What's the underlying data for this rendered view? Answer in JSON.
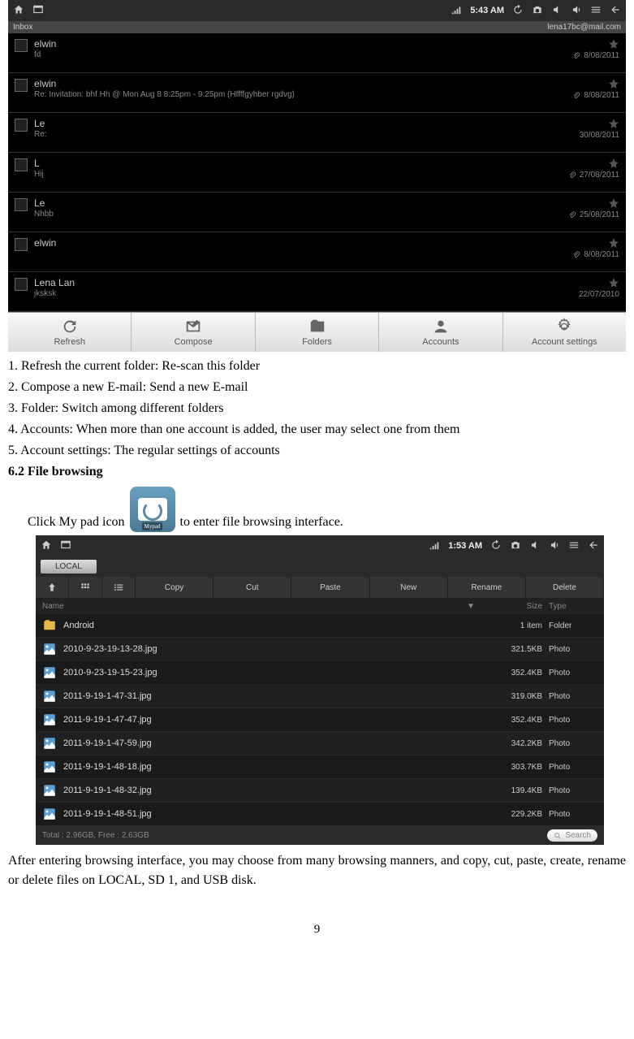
{
  "email_screenshot": {
    "statusbar": {
      "time": "5:43 AM"
    },
    "inbox_label": "Inbox",
    "account": "lena17bc@mail.com",
    "items": [
      {
        "sender": "elwin",
        "subject": "fd",
        "date": "8/08/2011",
        "attach": true
      },
      {
        "sender": "elwin",
        "subject": "Re: Invitation: bhf Hh @ Mon Aug 8 8:25pm - 9:25pm (Hffffgyhber rgdvg)",
        "date": "8/08/2011",
        "attach": true
      },
      {
        "sender": "Le",
        "subject": "Re:",
        "date": "30/08/2011",
        "attach": false
      },
      {
        "sender": "L",
        "subject": "Hij",
        "date": "27/08/2011",
        "attach": true
      },
      {
        "sender": "Le",
        "subject": "Nhbb",
        "date": "25/08/2011",
        "attach": true
      },
      {
        "sender": "elwin",
        "subject": "",
        "date": "8/08/2011",
        "attach": true
      },
      {
        "sender": "Lena Lan",
        "subject": "jksksk",
        "date": "22/07/2010",
        "attach": false
      }
    ],
    "toolbar": [
      "Refresh",
      "Compose",
      "Folders",
      "Accounts",
      "Account settings"
    ]
  },
  "doc_list": [
    "1. Refresh the current folder: Re-scan this folder",
    "2. Compose a new E-mail: Send a new E-mail",
    "3. Folder: Switch among different folders",
    "4. Accounts: When more than one account is added, the user may select one from them",
    "5. Account settings: The regular settings of accounts"
  ],
  "section_62": "6.2 File browsing",
  "mypad": {
    "pre": "Click My pad icon",
    "post": " to enter file browsing interface.",
    "label": "Mypad"
  },
  "file_screenshot": {
    "statusbar": {
      "time": "1:53 AM"
    },
    "tab": "LOCAL",
    "actions": [
      "Copy",
      "Cut",
      "Paste",
      "New",
      "Rename",
      "Delete"
    ],
    "headers": {
      "name": "Name",
      "size": "Size",
      "type": "Type"
    },
    "rows": [
      {
        "icon": "folder",
        "name": "Android",
        "size": "1 item",
        "type": "Folder"
      },
      {
        "icon": "photo",
        "name": "2010-9-23-19-13-28.jpg",
        "size": "321.5KB",
        "type": "Photo"
      },
      {
        "icon": "photo",
        "name": "2010-9-23-19-15-23.jpg",
        "size": "352.4KB",
        "type": "Photo"
      },
      {
        "icon": "photo",
        "name": "2011-9-19-1-47-31.jpg",
        "size": "319.0KB",
        "type": "Photo"
      },
      {
        "icon": "photo",
        "name": "2011-9-19-1-47-47.jpg",
        "size": "352.4KB",
        "type": "Photo"
      },
      {
        "icon": "photo",
        "name": "2011-9-19-1-47-59.jpg",
        "size": "342.2KB",
        "type": "Photo"
      },
      {
        "icon": "photo",
        "name": "2011-9-19-1-48-18.jpg",
        "size": "303.7KB",
        "type": "Photo"
      },
      {
        "icon": "photo",
        "name": "2011-9-19-1-48-32.jpg",
        "size": "139.4KB",
        "type": "Photo"
      },
      {
        "icon": "photo",
        "name": "2011-9-19-1-48-51.jpg",
        "size": "229.2KB",
        "type": "Photo"
      }
    ],
    "footer": "Total : 2.96GB, Free : 2.63GB",
    "search": "Search"
  },
  "para_after": "After entering browsing interface, you may choose from many browsing manners, and copy, cut, paste, create, rename or delete files on LOCAL, SD 1, and USB disk.",
  "page_number": "9"
}
